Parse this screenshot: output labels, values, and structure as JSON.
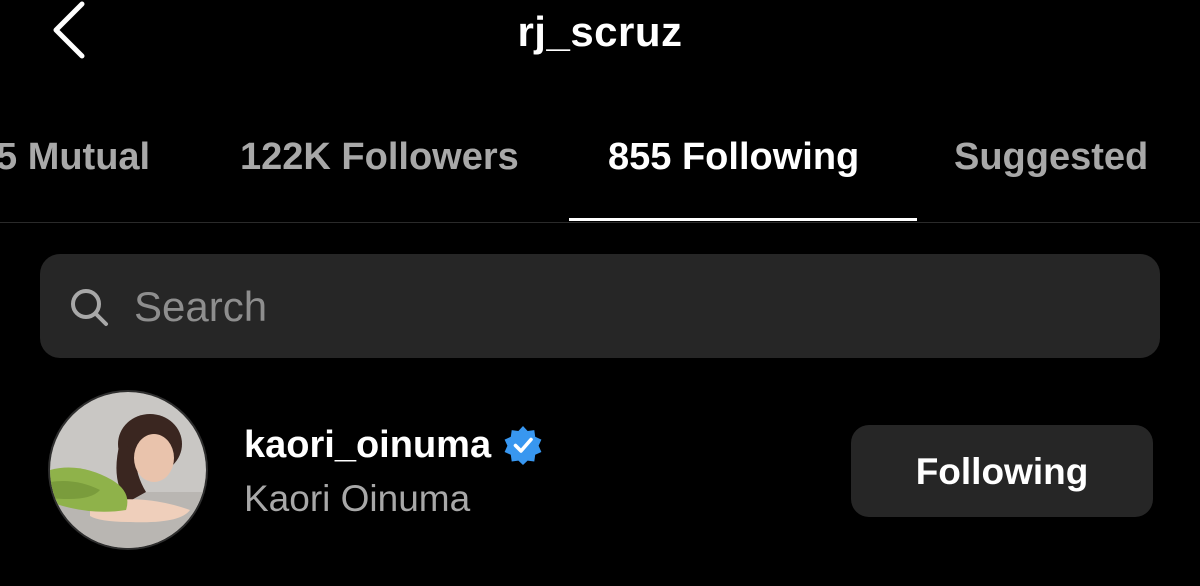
{
  "header": {
    "title": "rj_scruz",
    "back_icon": "chevron-left-icon"
  },
  "tabs": [
    {
      "label": "5 Mutual",
      "active": false
    },
    {
      "label": "122K Followers",
      "active": false
    },
    {
      "label": "855 Following",
      "active": true
    },
    {
      "label": "Suggested",
      "active": false
    }
  ],
  "search": {
    "placeholder": "Search",
    "value": "",
    "icon": "search-icon"
  },
  "list": [
    {
      "username": "kaori_oinuma",
      "full_name": "Kaori Oinuma",
      "verified": true,
      "verified_icon": "verified-badge-icon",
      "button_label": "Following"
    }
  ],
  "colors": {
    "background": "#000000",
    "text_primary": "#ffffff",
    "text_secondary": "#a8a8a8",
    "surface": "#262626",
    "verified_blue": "#3897f0"
  }
}
